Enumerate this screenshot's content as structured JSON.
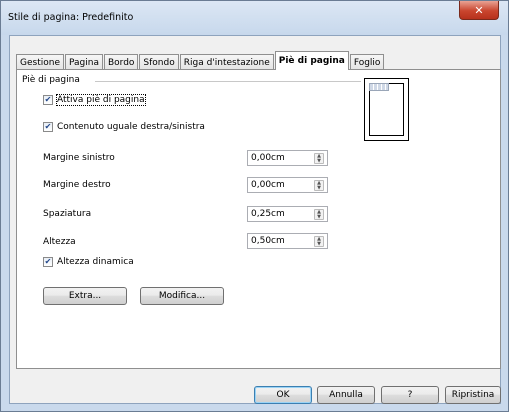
{
  "window": {
    "title": "Stile di pagina: Predefinito"
  },
  "tabs": [
    {
      "label": "Gestione"
    },
    {
      "label": "Pagina"
    },
    {
      "label": "Bordo"
    },
    {
      "label": "Sfondo"
    },
    {
      "label": "Riga d'intestazione"
    },
    {
      "label": "Piè di pagina",
      "active": true
    },
    {
      "label": "Foglio"
    }
  ],
  "footer_section": {
    "title": "Piè di pagina",
    "activate": {
      "label": "Attiva piè di pagina",
      "checked": true
    },
    "same_content": {
      "label": "Contenuto uguale destra/sinistra",
      "checked": true
    },
    "left_margin": {
      "label": "Margine sinistro",
      "value": "0,00cm"
    },
    "right_margin": {
      "label": "Margine destro",
      "value": "0,00cm"
    },
    "spacing": {
      "label": "Spaziatura",
      "value": "0,25cm"
    },
    "height": {
      "label": "Altezza",
      "value": "0,50cm"
    },
    "dynamic_height": {
      "label": "Altezza dinamica",
      "checked": true
    }
  },
  "buttons": {
    "extra": "Extra...",
    "edit": "Modifica...",
    "ok": "OK",
    "cancel": "Annulla",
    "help": "?",
    "reset": "Ripristina"
  },
  "icons": {
    "close": "close-icon",
    "check": "checkmark-icon",
    "spin": "spin-arrows-icon"
  },
  "colors": {
    "title_bar": "#c7d8ec",
    "close_button": "#c9452e",
    "default_button_border": "#3c7fb1",
    "checkmark": "#22478a"
  }
}
